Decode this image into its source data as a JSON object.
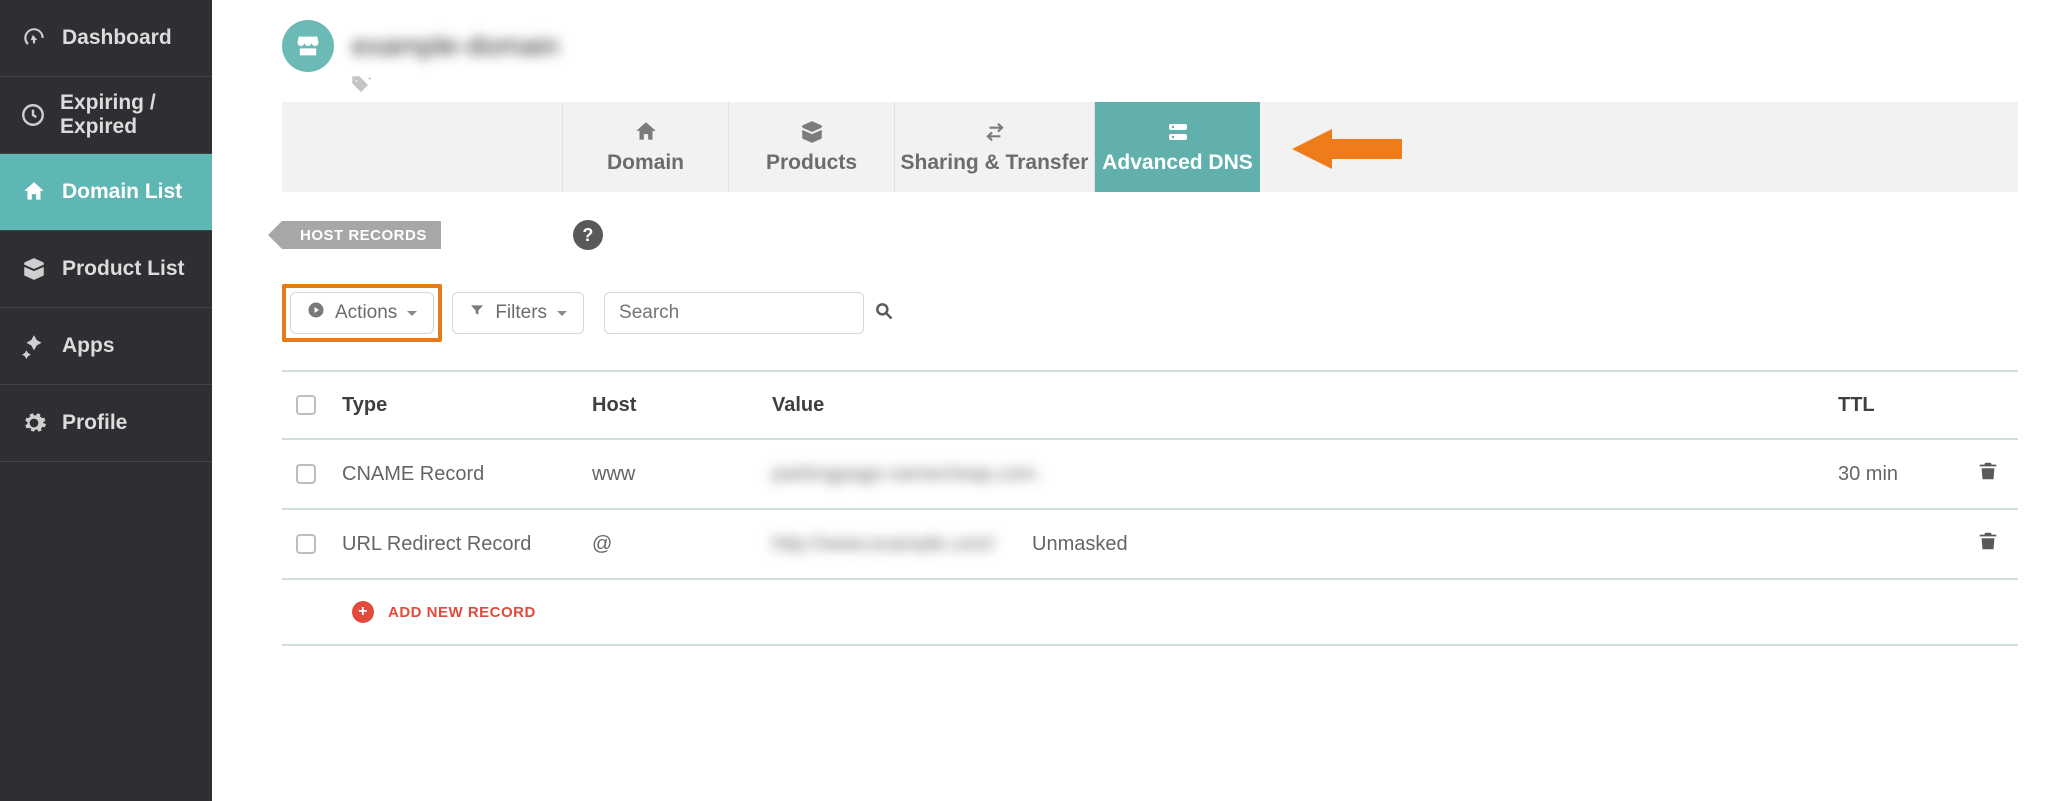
{
  "sidebar": {
    "items": [
      {
        "label": "Dashboard"
      },
      {
        "label": "Expiring / Expired"
      },
      {
        "label": "Domain List"
      },
      {
        "label": "Product List"
      },
      {
        "label": "Apps"
      },
      {
        "label": "Profile"
      }
    ]
  },
  "domain_title": "example-domain",
  "tabs": {
    "domain": "Domain",
    "products": "Products",
    "sharing": "Sharing & Transfer",
    "advanced_dns": "Advanced DNS"
  },
  "section_label": "HOST RECORDS",
  "help_char": "?",
  "toolbar": {
    "actions": "Actions",
    "filters": "Filters",
    "search_placeholder": "Search"
  },
  "headers": {
    "type": "Type",
    "host": "Host",
    "value": "Value",
    "ttl": "TTL"
  },
  "rows": [
    {
      "type": "CNAME Record",
      "host": "www",
      "value": "parkingpage.namecheap.com.",
      "extra": "",
      "ttl": "30 min"
    },
    {
      "type": "URL Redirect Record",
      "host": "@",
      "value": "http://www.example.com/",
      "extra": "Unmasked",
      "ttl": ""
    }
  ],
  "add_new": "ADD NEW RECORD"
}
